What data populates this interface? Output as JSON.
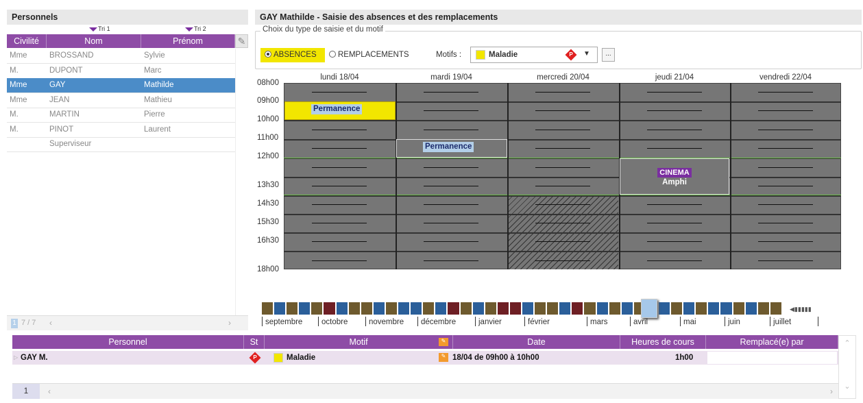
{
  "personnels": {
    "title": "Personnels",
    "tri1": "Tri 1",
    "tri2": "Tri 2",
    "headers": [
      "Civilité",
      "Nom",
      "Prénom"
    ],
    "rows": [
      {
        "civ": "Mme",
        "nom": "BROSSAND",
        "prenom": "Sylvie"
      },
      {
        "civ": "M.",
        "nom": "DUPONT",
        "prenom": "Marc"
      },
      {
        "civ": "Mme",
        "nom": "GAY",
        "prenom": "Mathilde"
      },
      {
        "civ": "Mme",
        "nom": "JEAN",
        "prenom": "Mathieu"
      },
      {
        "civ": "M.",
        "nom": "MARTIN",
        "prenom": "Pierre"
      },
      {
        "civ": "M.",
        "nom": "PINOT",
        "prenom": "Laurent"
      },
      {
        "civ": "",
        "nom": "Superviseur",
        "prenom": ""
      }
    ],
    "page": "1",
    "count": "7 / 7"
  },
  "saisie": {
    "title": "GAY Mathilde - Saisie des absences et des remplacements",
    "group_label": "Choix du type de saisie et du motif",
    "radio_absences": "ABSENCES",
    "radio_remplacements": "REMPLACEMENTS",
    "motifs_label": "Motifs :",
    "motif_value": "Maladie",
    "more_button": "..."
  },
  "calendar": {
    "days": [
      "lundi 18/04",
      "mardi 19/04",
      "mercredi 20/04",
      "jeudi 21/04",
      "vendredi 22/04"
    ],
    "times": [
      "08h00",
      "09h00",
      "10h00",
      "11h00",
      "12h00",
      "13h30",
      "14h30",
      "15h30",
      "16h30",
      "18h00"
    ],
    "events": {
      "perm1": "Permanence",
      "perm2": "Permanence",
      "cinema": "CINEMA",
      "cinema_room": "Amphi"
    }
  },
  "timeline": {
    "months": [
      "septembre",
      "octobre",
      "novembre",
      "décembre",
      "janvier",
      "février",
      "mars",
      "avril",
      "mai",
      "juin",
      "juillet"
    ]
  },
  "absences_table": {
    "headers": [
      "Personnel",
      "St",
      "Motif",
      "Date",
      "Heures de cours",
      "Remplacé(e) par"
    ],
    "row": {
      "personnel": "GAY M.",
      "motif": "Maladie",
      "date": "18/04 de 09h00 à 10h00",
      "heures": "1h00",
      "remplace": ""
    },
    "page": "1"
  },
  "colors": {
    "header_purple": "#8e4ca6",
    "selection_blue": "#4b8cc8",
    "absence_yellow": "#f2e600",
    "grid_gray": "#767676"
  }
}
